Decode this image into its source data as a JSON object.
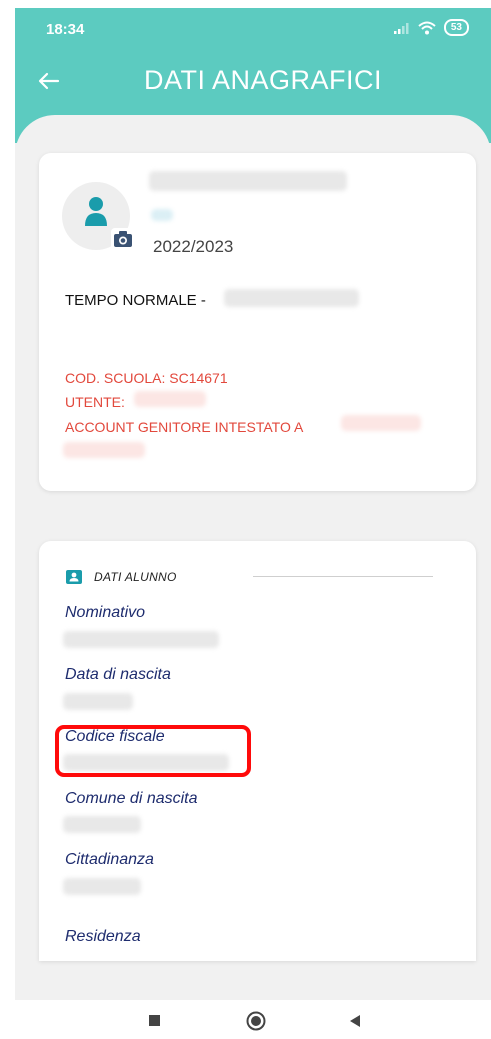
{
  "status_bar": {
    "time": "18:34",
    "battery": "53"
  },
  "header": {
    "title": "DATI ANAGRAFICI"
  },
  "profile": {
    "school_year": "2022/2023",
    "class_time_label": "TEMPO NORMALE -",
    "school_code": "COD. SCUOLA: SC14671",
    "user_label": "UTENTE:",
    "account_label": "ACCOUNT GENITORE INTESTATO A"
  },
  "student_section": {
    "title": "DATI ALUNNO",
    "fields": [
      {
        "label": "Nominativo"
      },
      {
        "label": "Data di nascita"
      },
      {
        "label": "Codice fiscale"
      },
      {
        "label": "Comune di nascita"
      },
      {
        "label": "Cittadinanza"
      },
      {
        "label": "Residenza"
      }
    ]
  },
  "colors": {
    "app_bar": "#5ccbc0",
    "accent_red": "#e2483c",
    "label_blue": "#1e2c6e",
    "highlight": "#ff0a0a"
  }
}
